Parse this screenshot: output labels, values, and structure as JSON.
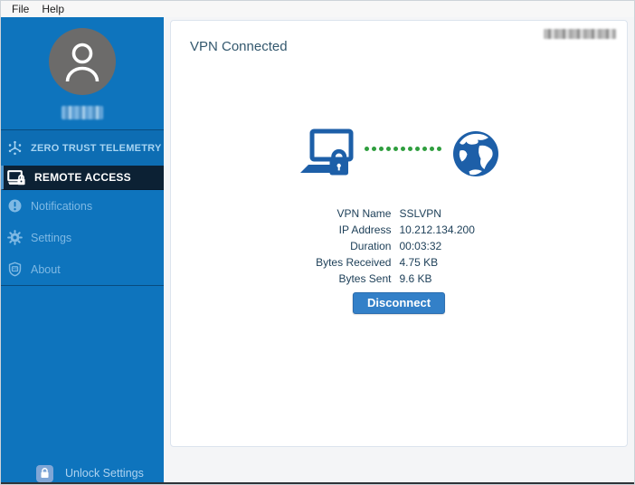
{
  "menu": {
    "items": [
      "File",
      "Help"
    ]
  },
  "sidebar": {
    "items": [
      {
        "label": "ZERO TRUST TELEMETRY",
        "selected": false
      },
      {
        "label": "REMOTE ACCESS",
        "selected": true
      },
      {
        "label": "Notifications",
        "selected": false
      },
      {
        "label": "Settings",
        "selected": false
      },
      {
        "label": "About",
        "selected": false
      }
    ],
    "footer_label": "Unlock Settings"
  },
  "main": {
    "title": "VPN Connected",
    "details": [
      {
        "label": "VPN Name",
        "value": "SSLVPN"
      },
      {
        "label": "IP Address",
        "value": "10.212.134.200"
      },
      {
        "label": "Duration",
        "value": "00:03:32"
      },
      {
        "label": "Bytes Received",
        "value": "4.75 KB"
      },
      {
        "label": "Bytes Sent",
        "value": "9.6 KB"
      }
    ],
    "disconnect_label": "Disconnect"
  },
  "colors": {
    "sidebar_blue": "#0e74bd",
    "selected_navy": "#0c2134",
    "connection_green": "#2f9e3e",
    "button_blue": "#3380c8",
    "graphic_blue": "#1d5fa8"
  }
}
